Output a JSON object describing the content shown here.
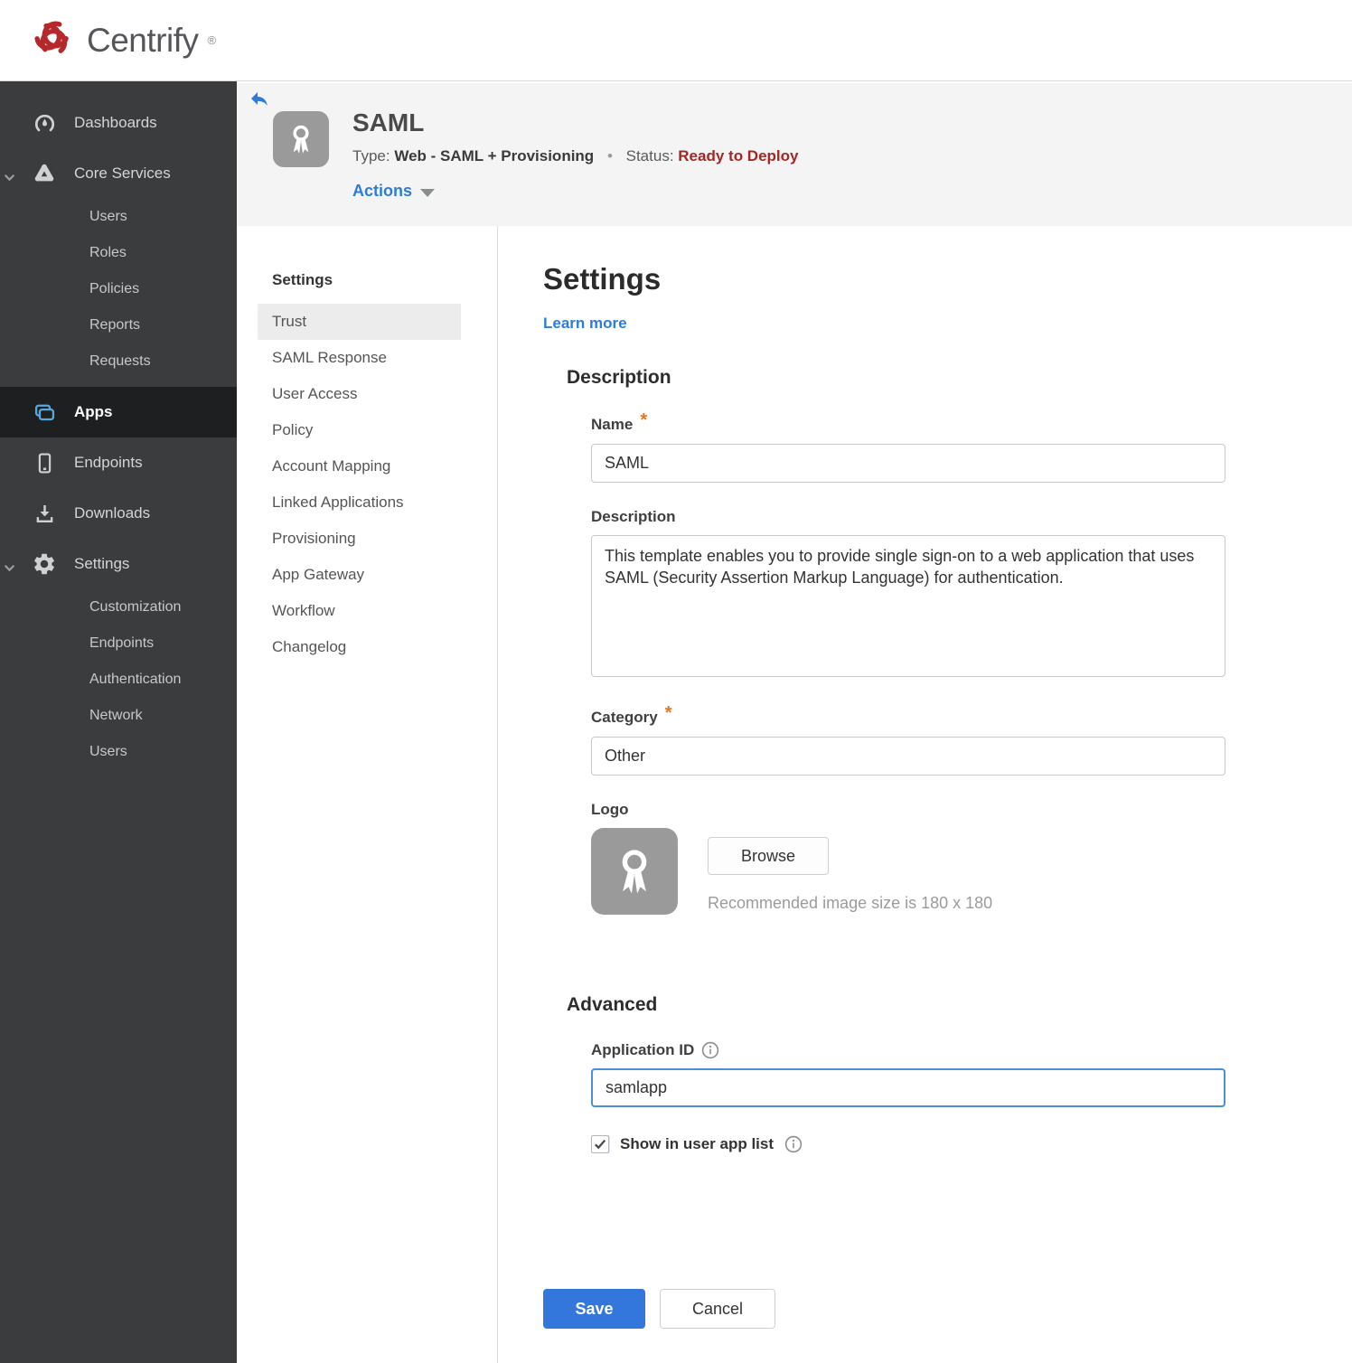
{
  "brand": {
    "name": "Centrify",
    "registered": "®"
  },
  "sidebar": {
    "items": [
      {
        "label": "Dashboards",
        "icon": "gauge-icon"
      },
      {
        "label": "Core Services",
        "icon": "core-services-icon",
        "expanded": true,
        "children": [
          "Users",
          "Roles",
          "Policies",
          "Reports",
          "Requests"
        ]
      },
      {
        "label": "Apps",
        "icon": "apps-icon",
        "active": true
      },
      {
        "label": "Endpoints",
        "icon": "device-icon"
      },
      {
        "label": "Downloads",
        "icon": "download-icon"
      },
      {
        "label": "Settings",
        "icon": "gear-icon",
        "expanded": true,
        "children": [
          "Customization",
          "Endpoints",
          "Authentication",
          "Network",
          "Users"
        ]
      }
    ]
  },
  "header": {
    "app_name": "SAML",
    "type_label": "Type:",
    "type_value": "Web - SAML + Provisioning",
    "separator": "•",
    "status_label": "Status:",
    "status_value": "Ready to Deploy",
    "actions_label": "Actions"
  },
  "subnav": {
    "title": "Settings",
    "selected": "Trust",
    "items": [
      "Trust",
      "SAML Response",
      "User Access",
      "Policy",
      "Account Mapping",
      "Linked Applications",
      "Provisioning",
      "App Gateway",
      "Workflow",
      "Changelog"
    ]
  },
  "main": {
    "title": "Settings",
    "learn_more_label": "Learn more",
    "required_marker": "*",
    "description": {
      "section_title": "Description",
      "name_label": "Name",
      "name_value": "SAML",
      "description_label": "Description",
      "description_value": "This template enables you to provide single sign-on to a web application that uses SAML (Security Assertion Markup Language) for authentication.",
      "category_label": "Category",
      "category_value": "Other",
      "logo_label": "Logo",
      "browse_label": "Browse",
      "recommended_text": "Recommended image size is 180 x 180"
    },
    "advanced": {
      "section_title": "Advanced",
      "application_id_label": "Application ID",
      "application_id_value": "samlapp",
      "show_in_user_app_list_label": "Show in user app list",
      "show_in_user_app_list_checked": true
    },
    "footer": {
      "save_label": "Save",
      "cancel_label": "Cancel"
    }
  },
  "colors": {
    "accent_blue": "#2e7cd6",
    "save_blue": "#3377dd",
    "status_red": "#a32723",
    "required_orange": "#e8741c",
    "sidebar_bg": "#3a3c3d",
    "sidebar_active_bg": "#1d1f20",
    "apps_icon_blue": "#54a9e3",
    "header_bg": "#f4f4f5",
    "focus_border": "#4a90d9",
    "brand_red": "#b5282c"
  }
}
